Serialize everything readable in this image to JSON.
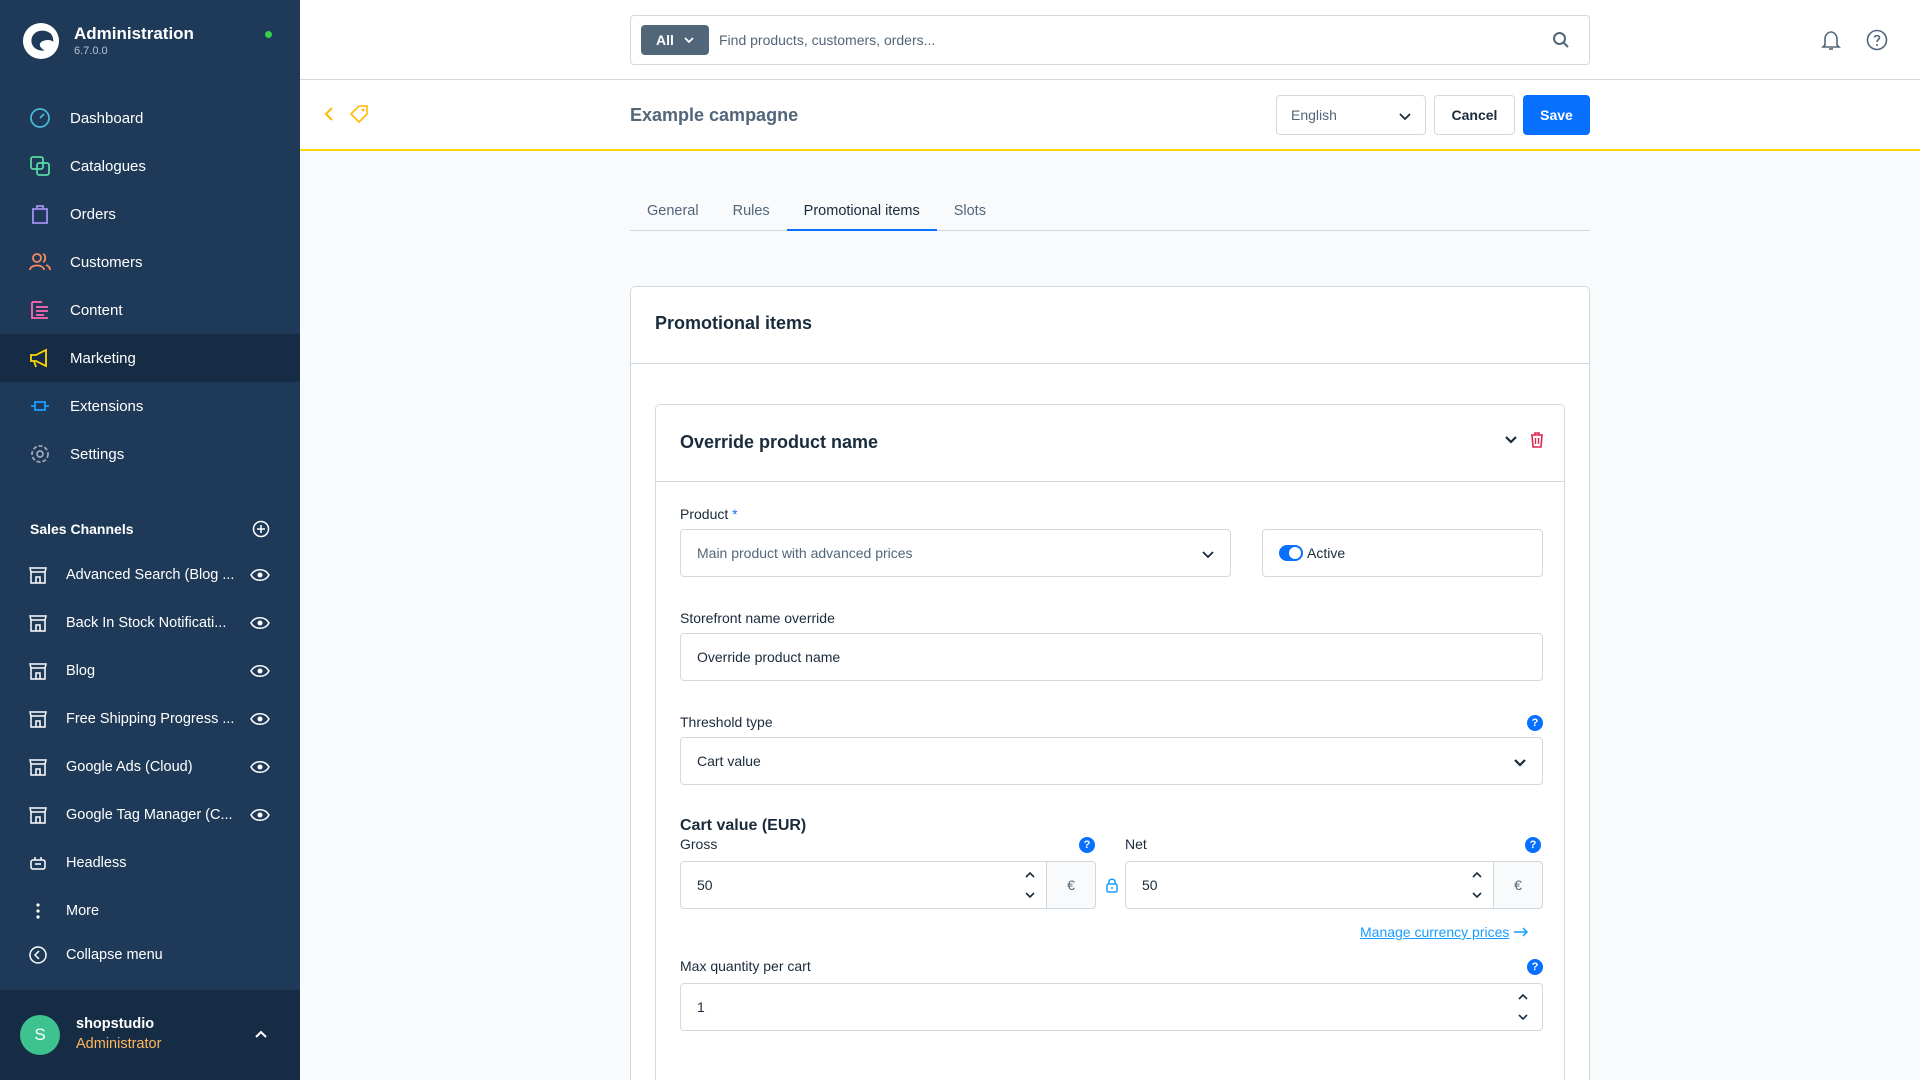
{
  "app": {
    "title": "Administration",
    "version": "6.7.0.0"
  },
  "nav": [
    {
      "label": "Dashboard",
      "icon": "dashboard-icon"
    },
    {
      "label": "Catalogues",
      "icon": "catalogue-icon"
    },
    {
      "label": "Orders",
      "icon": "orders-icon"
    },
    {
      "label": "Customers",
      "icon": "customers-icon"
    },
    {
      "label": "Content",
      "icon": "content-icon"
    },
    {
      "label": "Marketing",
      "icon": "marketing-icon",
      "active": true
    },
    {
      "label": "Extensions",
      "icon": "extensions-icon"
    },
    {
      "label": "Settings",
      "icon": "settings-icon"
    }
  ],
  "sales_channels": {
    "title": "Sales Channels",
    "items": [
      {
        "label": "Advanced Search (Blog ..."
      },
      {
        "label": "Back In Stock Notificati..."
      },
      {
        "label": "Blog"
      },
      {
        "label": "Free Shipping Progress ..."
      },
      {
        "label": "Google Ads (Cloud)"
      },
      {
        "label": "Google Tag Manager (C..."
      },
      {
        "label": "Headless"
      },
      {
        "label": "More"
      }
    ],
    "collapse_label": "Collapse menu"
  },
  "user": {
    "initial": "S",
    "name": "shopstudio",
    "role": "Administrator"
  },
  "search": {
    "type": "All",
    "placeholder": "Find products, customers, orders..."
  },
  "smartbar": {
    "title": "Example campagne",
    "language": "English",
    "cancel": "Cancel",
    "save": "Save"
  },
  "tabs": [
    {
      "label": "General"
    },
    {
      "label": "Rules"
    },
    {
      "label": "Promotional items",
      "active": true
    },
    {
      "label": "Slots"
    }
  ],
  "card": {
    "title": "Promotional items",
    "item": {
      "title": "Override product name",
      "product_label": "Product",
      "required_mark": "*",
      "product_value": "Main product with advanced prices",
      "active_label": "Active",
      "storefront_label": "Storefront name override",
      "storefront_value": "Override product name",
      "threshold_label": "Threshold type",
      "threshold_value": "Cart value",
      "cart_value_title": "Cart value (EUR)",
      "gross_label": "Gross",
      "gross_value": "50",
      "net_label": "Net",
      "net_value": "50",
      "currency_symbol": "€",
      "manage_link": "Manage currency prices",
      "max_qty_label": "Max quantity per cart",
      "max_qty_value": "1",
      "help_glyph": "?"
    }
  },
  "colors": {
    "sidebar": "#1f3a58",
    "accent": "#0870ff",
    "smartbar_border": "#ffd700",
    "status_online": "#37d046"
  }
}
